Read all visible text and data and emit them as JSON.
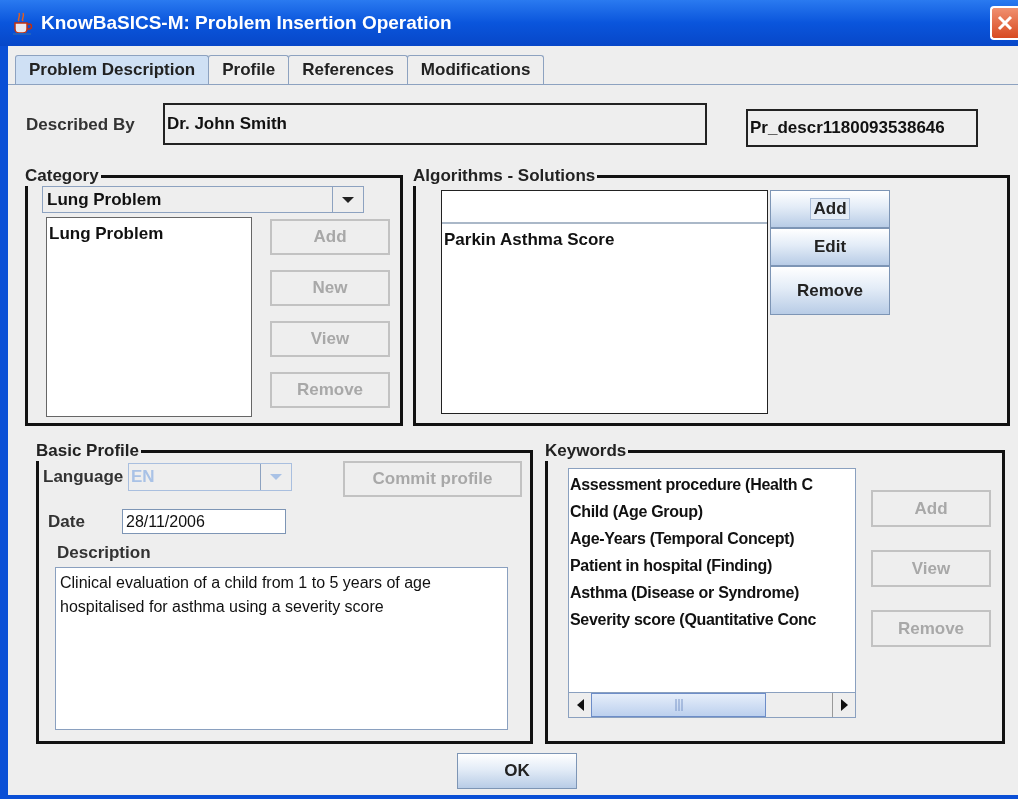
{
  "window": {
    "title": "KnowBaSICS-M: Problem Insertion Operation"
  },
  "tabs": [
    {
      "label": "Problem Description",
      "selected": true
    },
    {
      "label": "Profile",
      "selected": false
    },
    {
      "label": "References",
      "selected": false
    },
    {
      "label": "Modifications",
      "selected": false
    }
  ],
  "described_by": {
    "label": "Described By",
    "value": "Dr. John Smith"
  },
  "record_id": {
    "value": "Pr_descr1180093538646"
  },
  "category": {
    "title": "Category",
    "dropdown": "Lung Problem",
    "items": [
      "Lung Problem"
    ],
    "buttons": [
      {
        "label": "Add",
        "disabled": true,
        "focused": false
      },
      {
        "label": "New",
        "disabled": true,
        "focused": false
      },
      {
        "label": "View",
        "disabled": true,
        "focused": false
      },
      {
        "label": "Remove",
        "disabled": true,
        "focused": false
      }
    ]
  },
  "algorithms": {
    "title": "Algorithms - Solutions",
    "items": [
      "Parkin Asthma Score"
    ],
    "buttons": [
      {
        "label": "Add",
        "disabled": false,
        "focused": true
      },
      {
        "label": "Edit",
        "disabled": false,
        "focused": false
      },
      {
        "label": "Remove",
        "disabled": false,
        "focused": false
      }
    ]
  },
  "basic_profile": {
    "title": "Basic Profile",
    "language": {
      "label": "Language",
      "value": "EN",
      "disabled": true
    },
    "commit_button": {
      "label": "Commit profile",
      "disabled": true,
      "focused": false
    },
    "date": {
      "label": "Date",
      "value": "28/11/2006"
    },
    "description": {
      "label": "Description",
      "value": "Clinical evaluation of a child from 1 to 5 years of age hospitalised for asthma using a severity score"
    }
  },
  "keywords": {
    "title": "Keywords",
    "items": [
      "Assessment procedure (Health C",
      "Child (Age Group)",
      "Age-Years (Temporal Concept)",
      "Patient in hospital (Finding)",
      "Asthma (Disease or Syndrome)",
      "Severity score (Quantitative Conc"
    ],
    "buttons": [
      {
        "label": "Add",
        "disabled": true,
        "focused": false
      },
      {
        "label": "View",
        "disabled": true,
        "focused": false
      },
      {
        "label": "Remove",
        "disabled": true,
        "focused": false
      }
    ]
  },
  "ok_button": {
    "label": "OK",
    "disabled": false,
    "focused": false
  }
}
